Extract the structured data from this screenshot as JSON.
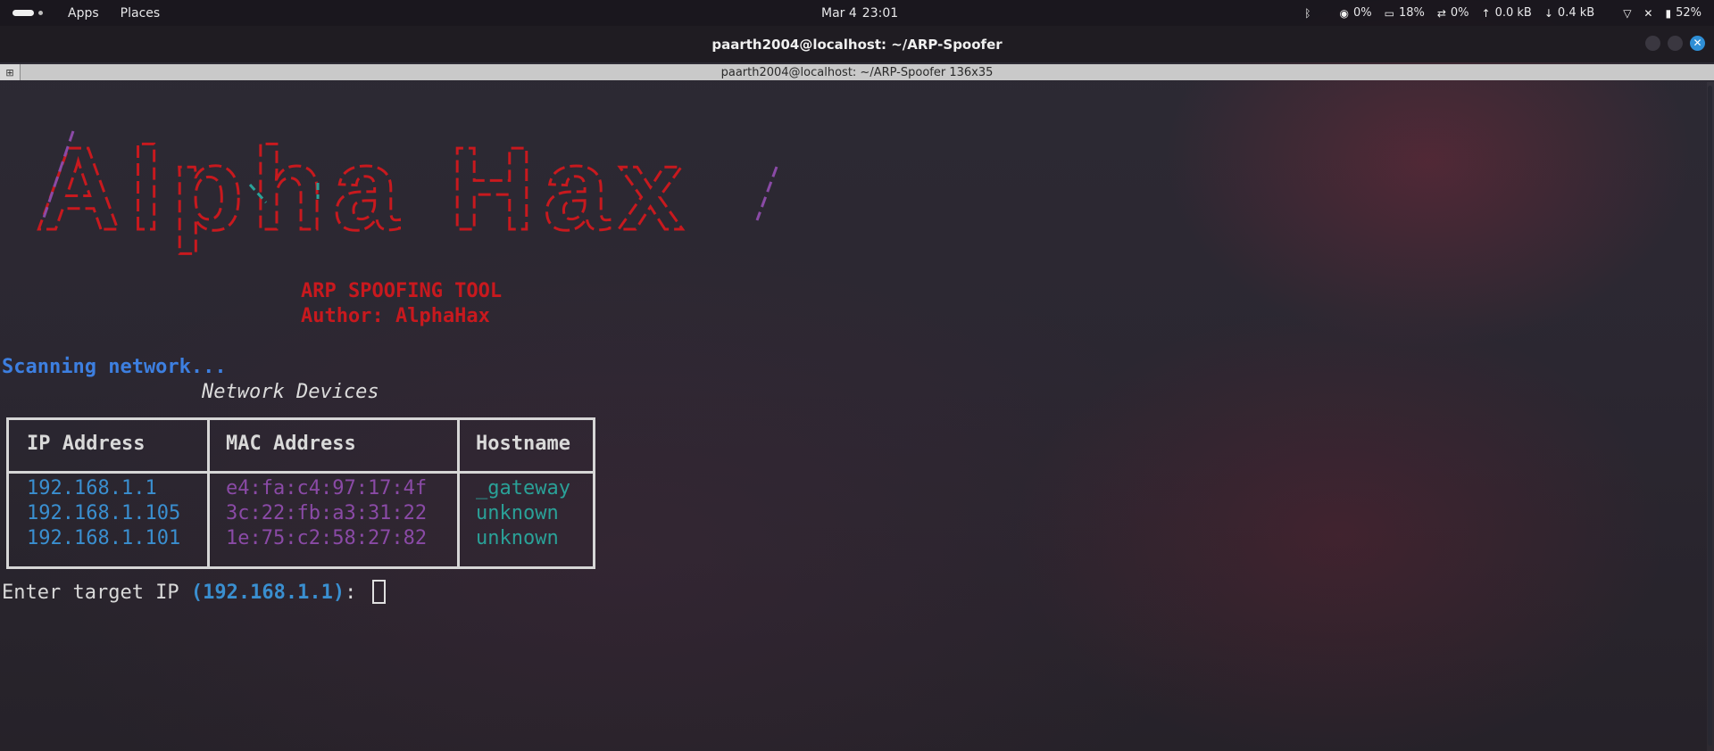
{
  "topbar": {
    "apps_label": "Apps",
    "places_label": "Places",
    "date": "Mar 4",
    "time": "23:01",
    "cpu": "0%",
    "mem": "18%",
    "swap": "0%",
    "net_up": "0.0 kB",
    "net_down": "0.4 kB",
    "battery": "52%"
  },
  "window": {
    "title": "paarth2004@localhost: ~/ARP-Spoofer",
    "tab_title": "paarth2004@localhost: ~/ARP-Spoofer 136x35"
  },
  "terminal": {
    "banner_text": "Alpha Hax",
    "tool_name": "ARP SPOOFING TOOL",
    "author": "Author: AlphaHax",
    "scanning": "Scanning network...",
    "table_title": "Network Devices",
    "headers": [
      "IP Address",
      "MAC Address",
      "Hostname"
    ],
    "rows": [
      {
        "ip": "192.168.1.1",
        "mac": "e4:fa:c4:97:17:4f",
        "host": "_gateway"
      },
      {
        "ip": "192.168.1.105",
        "mac": "3c:22:fb:a3:31:22",
        "host": "unknown"
      },
      {
        "ip": "192.168.1.101",
        "mac": "1e:75:c2:58:27:82",
        "host": "unknown"
      }
    ],
    "prompt_prefix": "Enter target IP ",
    "prompt_open": "(",
    "prompt_default": "192.168.1.1",
    "prompt_close": ")",
    "prompt_suffix": ": "
  },
  "colors": {
    "banner_red": "#c8191e",
    "banner_purple": "#8a4aa6",
    "banner_teal": "#2aa198",
    "ip_blue": "#3a8fd0",
    "scan_blue": "#3d7fe0"
  },
  "icons": [
    "activities-icon",
    "bluetooth-icon",
    "cpu-icon",
    "memory-icon",
    "swap-icon",
    "upload-icon",
    "download-icon",
    "wifi-icon",
    "mute-icon",
    "battery-icon",
    "close-icon"
  ]
}
